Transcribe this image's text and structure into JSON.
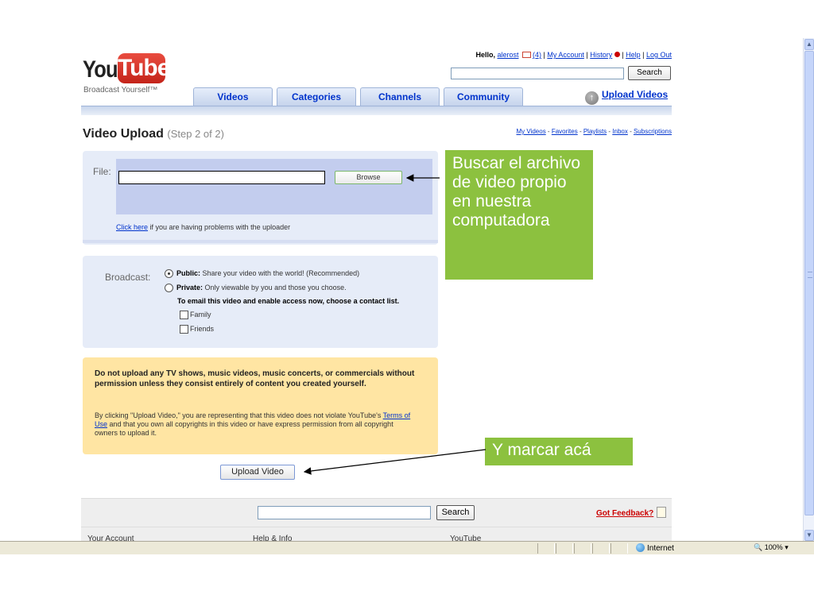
{
  "header": {
    "logo_you": "You",
    "logo_tube": "Tube",
    "tagline": "Broadcast Yourself™",
    "hello": "Hello,",
    "username": "alerost",
    "mail_count": "(4)",
    "sep": " | ",
    "my_account": "My Account",
    "history": "History",
    "help": "Help",
    "log_out": "Log Out",
    "search_button": "Search"
  },
  "nav": {
    "tabs": [
      "Videos",
      "Categories",
      "Channels",
      "Community"
    ],
    "upload_videos": "Upload Videos"
  },
  "page": {
    "title": "Video Upload",
    "step": "(Step 2 of 2)",
    "sublinks": [
      "My Videos",
      "Favorites",
      "Playlists",
      "Inbox",
      "Subscriptions"
    ],
    "sublink_sep": " - "
  },
  "file_section": {
    "label": "File:",
    "browse": "Browse",
    "click_here": "Click here",
    "problem_text": " if you are having problems with the uploader"
  },
  "broadcast": {
    "label": "Broadcast:",
    "public_bold": "Public:",
    "public_text": " Share your video with the world! (Recommended)",
    "private_bold": "Private:",
    "private_text": " Only viewable by you and those you choose.",
    "email_note": "To email this video and enable access now, choose a contact list.",
    "family": "Family",
    "friends": "Friends",
    "selected": "Public"
  },
  "warning": {
    "strong": "Do not upload any TV shows, music videos, music concerts, or commercials without permission unless they consist entirely of content you created yourself.",
    "body_1": "By clicking \"Upload Video,\" you are representing that this video does not violate YouTube's ",
    "terms": "Terms of Use",
    "body_2": " and that you own all copyrights in this video or have express permission from all copyright owners to upload it."
  },
  "upload_button": "Upload Video",
  "footer": {
    "search_button": "Search",
    "feedback": "Got Feedback?",
    "columns": [
      "Your Account",
      "Help & Info",
      "YouTube"
    ]
  },
  "annotations": {
    "file_callout": "Buscar el archivo de video propio en nuestra computadora",
    "upload_callout": "Y marcar acá"
  },
  "statusbar": {
    "zone": "Internet",
    "zoom": "100%"
  },
  "colors": {
    "callout": "#8cc13f",
    "panel_blue": "#e6ecf8",
    "panel_warning": "#ffe5a3",
    "link": "#0033cc"
  }
}
